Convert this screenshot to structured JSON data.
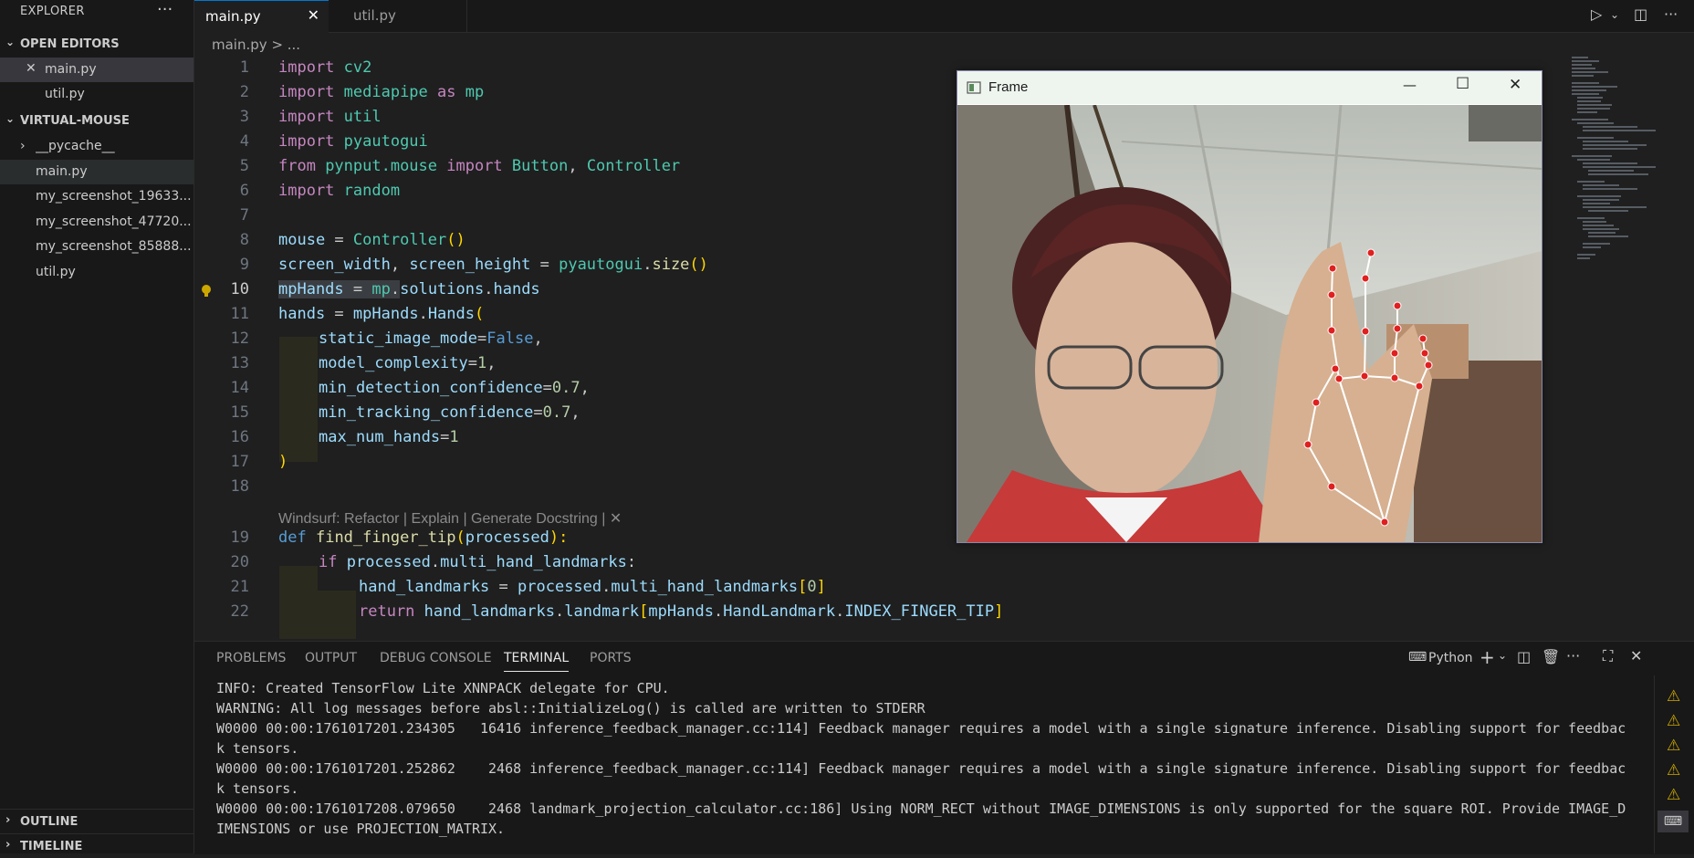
{
  "explorer": {
    "title": "EXPLORER",
    "more": "···",
    "open_editors": {
      "label": "OPEN EDITORS",
      "files": [
        "main.py",
        "util.py"
      ]
    },
    "project": {
      "label": "VIRTUAL-MOUSE",
      "items": [
        "__pycache__",
        "main.py",
        "my_screenshot_19633...",
        "my_screenshot_47720...",
        "my_screenshot_85888...",
        "util.py"
      ]
    },
    "outline": "OUTLINE",
    "timeline": "TIMELINE"
  },
  "tabs": [
    {
      "label": "main.py",
      "active": true
    },
    {
      "label": "util.py",
      "active": false
    }
  ],
  "breadcrumb": {
    "file": "main.py",
    "sep": "> ..."
  },
  "code": {
    "line_numbers": [
      "1",
      "2",
      "3",
      "4",
      "5",
      "6",
      "7",
      "8",
      "9",
      "10",
      "11",
      "12",
      "13",
      "14",
      "15",
      "16",
      "17",
      "18",
      "19",
      "20",
      "21",
      "22"
    ],
    "codelens": "Windsurf: Refactor | Explain | Generate Docstring | ✕",
    "l1": [
      "import",
      " cv2"
    ],
    "l2": [
      "import",
      " mediapipe ",
      "as",
      " mp"
    ],
    "l3": [
      "import",
      " util"
    ],
    "l4": [
      "import",
      " pyautogui"
    ],
    "l5": [
      "from",
      " pynput.mouse ",
      "import",
      " Button",
      ", ",
      "Controller"
    ],
    "l6": [
      "import",
      " random"
    ],
    "l8": [
      "mouse",
      " = ",
      "Controller",
      "()"
    ],
    "l9": [
      "screen_width",
      ", ",
      "screen_height",
      " = ",
      "pyautogui",
      ".",
      "size",
      "()"
    ],
    "l10": [
      "mpHands",
      " = ",
      "mp",
      ".",
      "solutions",
      ".",
      "hands"
    ],
    "l11": [
      "hands",
      " = ",
      "mpHands",
      ".",
      "Hands",
      "("
    ],
    "l12": [
      "static_image_mode",
      "=",
      "False",
      ","
    ],
    "l13": [
      "model_complexity",
      "=",
      "1",
      ","
    ],
    "l14": [
      "min_detection_confidence",
      "=",
      "0.7",
      ","
    ],
    "l15": [
      "min_tracking_confidence",
      "=",
      "0.7",
      ","
    ],
    "l16": [
      "max_num_hands",
      "=",
      "1"
    ],
    "l17": [
      ")"
    ],
    "l19": [
      "def",
      " ",
      "find_finger_tip",
      "(",
      "processed",
      "):"
    ],
    "l20": [
      "if",
      " ",
      "processed",
      ".",
      "multi_hand_landmarks",
      ":"
    ],
    "l21": [
      "hand_landmarks",
      " = ",
      "processed",
      ".",
      "multi_hand_landmarks",
      "[",
      "0",
      "]"
    ],
    "l22": [
      "return",
      " ",
      "hand_landmarks",
      ".",
      "landmark",
      "[",
      "mpHands",
      ".",
      "HandLandmark",
      ".",
      "INDEX_FINGER_TIP",
      "]"
    ]
  },
  "frame_window": {
    "title": "Frame",
    "minimize": "—",
    "maximize": "☐",
    "close": "✕"
  },
  "panel": {
    "tabs": [
      "PROBLEMS",
      "OUTPUT",
      "DEBUG CONSOLE",
      "TERMINAL",
      "PORTS"
    ],
    "active_tab": "TERMINAL",
    "terminal_profile": "Python",
    "lines": [
      "INFO: Created TensorFlow Lite XNNPACK delegate for CPU.",
      "WARNING: All log messages before absl::InitializeLog() is called are written to STDERR",
      "W0000 00:00:1761017201.234305   16416 inference_feedback_manager.cc:114] Feedback manager requires a model with a single signature inference. Disabling support for feedbac",
      "k tensors.",
      "W0000 00:00:1761017201.252862    2468 inference_feedback_manager.cc:114] Feedback manager requires a model with a single signature inference. Disabling support for feedbac",
      "k tensors.",
      "W0000 00:00:1761017208.079650    2468 landmark_projection_calculator.cc:186] Using NORM_RECT without IMAGE_DIMENSIONS is only supported for the square ROI. Provide IMAGE_D",
      "IMENSIONS or use PROJECTION_MATRIX."
    ]
  },
  "colors": {
    "accent": "#0078d4",
    "warning": "#cca700",
    "landmark": "#e02020"
  }
}
